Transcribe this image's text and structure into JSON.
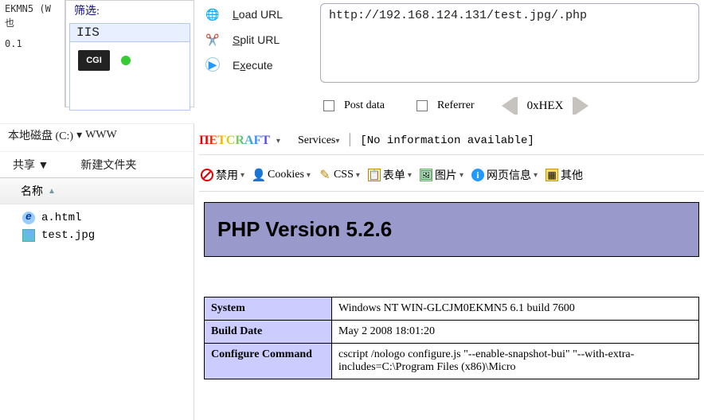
{
  "tree": {
    "l1": "EKMN5 (W",
    "l2": "也",
    "l3": "0.1"
  },
  "filter": {
    "label": "筛选:",
    "iis": "IIS",
    "cgi": "CGI"
  },
  "urlTools": {
    "load": "Load URL",
    "split": "Split URL",
    "execute": "Execute",
    "url": "http://192.168.124.131/test.jpg/.php"
  },
  "postrow": {
    "post": "Post data",
    "referrer": "Referrer",
    "hex": "0xHEX"
  },
  "explorer": {
    "crumb_drive": "本地磁盘 (C:)",
    "crumb_folder": "WWW",
    "share": "共享 ▼",
    "newfolder": "新建文件夹",
    "name_hdr": "名称",
    "files": [
      {
        "icon": "ie",
        "name": "a.html"
      },
      {
        "icon": "img",
        "name": "test.jpg"
      }
    ]
  },
  "netcraft": {
    "logo_n": "П",
    "logo_et": "ETCRAFT",
    "services": "Services",
    "noinfo": "[No information available]"
  },
  "toolbar2": {
    "forbid": "禁用",
    "cookies": "Cookies",
    "css": "CSS",
    "form": "表单",
    "img": "图片",
    "info": "网页信息",
    "other": "其他"
  },
  "php": {
    "title": "PHP Version 5.2.6",
    "rows": [
      {
        "k": "System",
        "v": "Windows NT WIN-GLCJM0EKMN5 6.1 build 7600"
      },
      {
        "k": "Build Date",
        "v": "May 2 2008 18:01:20"
      },
      {
        "k": "Configure Command",
        "v": "cscript /nologo configure.js \"--enable-snapshot-bui\" \"--with-extra-includes=C:\\Program Files (x86)\\Micro"
      }
    ]
  }
}
